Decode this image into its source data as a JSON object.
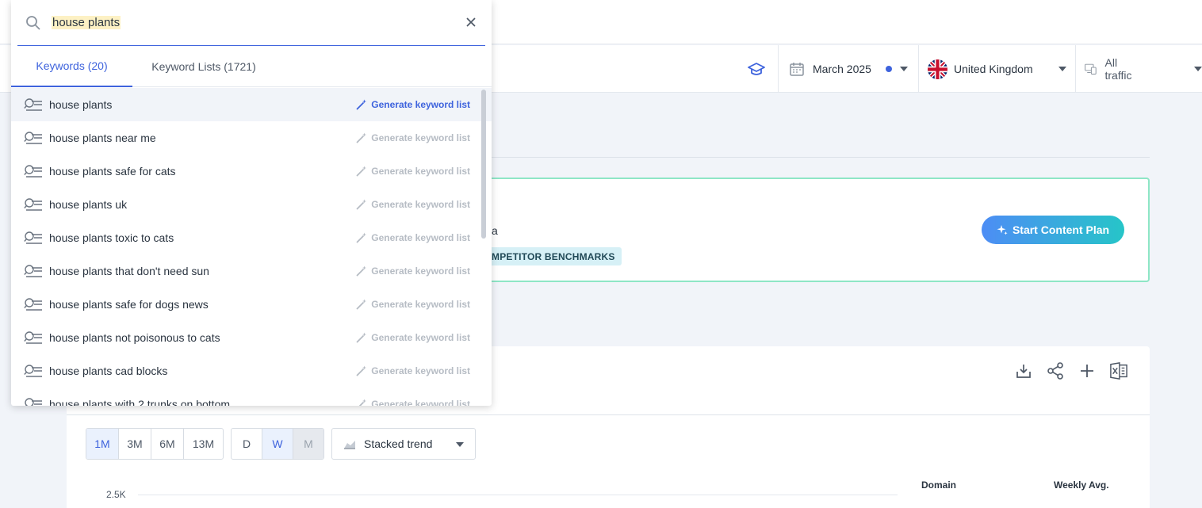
{
  "search": {
    "query": "house plants"
  },
  "tabs": [
    {
      "label": "Keywords (20)"
    },
    {
      "label": "Keyword Lists (1721)"
    }
  ],
  "keywords": [
    {
      "label": "house plants"
    },
    {
      "label": "house plants near me"
    },
    {
      "label": "house plants safe for cats"
    },
    {
      "label": "house plants uk"
    },
    {
      "label": "house plants toxic to cats"
    },
    {
      "label": "house plants that don't need sun"
    },
    {
      "label": "house plants safe for dogs news"
    },
    {
      "label": "house plants not poisonous to cats"
    },
    {
      "label": "house plants cad blocks"
    },
    {
      "label": "house plants with 2 trunks on bottom"
    }
  ],
  "generate_label": "Generate keyword list",
  "filters": {
    "date": "March 2025",
    "country": "United Kingdom",
    "traffic": "All traffic"
  },
  "banner": {
    "text_fragment": "a",
    "tag": "MPETITOR BENCHMARKS",
    "cta": "Start Content Plan"
  },
  "chart": {
    "ranges": [
      "1M",
      "3M",
      "6M",
      "13M"
    ],
    "granularity": [
      "D",
      "W",
      "M"
    ],
    "view": "Stacked trend",
    "column_domain": "Domain",
    "column_weekly": "Weekly Avg.",
    "y_tick": "2.5K"
  },
  "colors": {
    "accent": "#3e63dd",
    "banner_border": "#8ee6c6",
    "tag_bg": "#d6f0f6"
  }
}
